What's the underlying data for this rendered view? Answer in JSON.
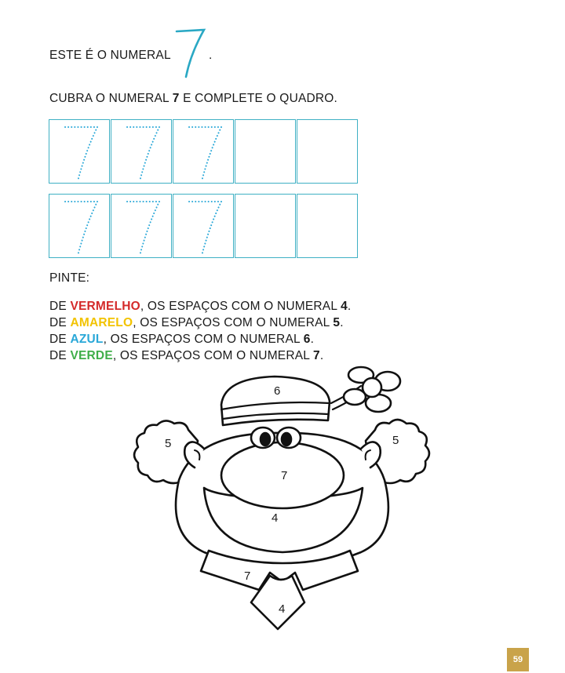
{
  "intro": {
    "text": "ESTE É O NUMERAL",
    "dot": "."
  },
  "instruction": {
    "pre": "CUBRA O NUMERAL ",
    "num": "7",
    "post": " E COMPLETE O QUADRO."
  },
  "grid": {
    "rows": 2,
    "cols": 5,
    "traced_cols": 3
  },
  "pinte": "PINTE:",
  "rules": [
    {
      "de": "DE ",
      "color": "VERMELHO",
      "rest": ", OS ESPAÇOS COM O NUMERAL ",
      "num": "4",
      "end": "."
    },
    {
      "de": "DE ",
      "color": "AMARELO",
      "rest": ", OS ESPAÇOS COM O NUMERAL ",
      "num": "5",
      "end": "."
    },
    {
      "de": "DE ",
      "color": "AZUL",
      "rest": ", OS ESPAÇOS COM O NUMERAL ",
      "num": "6",
      "end": "."
    },
    {
      "de": "DE ",
      "color": "VERDE",
      "rest": ", OS ESPAÇOS COM O NUMERAL ",
      "num": "7",
      "end": "."
    }
  ],
  "clown_labels": {
    "hat": "6",
    "left_hair": "5",
    "right_hair": "5",
    "nose": "7",
    "mouth": "4",
    "collar": "7",
    "tie": "4"
  },
  "page_number": "59",
  "colors": {
    "accent": "#3fb0c4",
    "red": "#d42a2a",
    "yellow": "#f2c300",
    "blue": "#2aa8d8",
    "green": "#3fae49",
    "page_badge": "#c9a34a"
  }
}
